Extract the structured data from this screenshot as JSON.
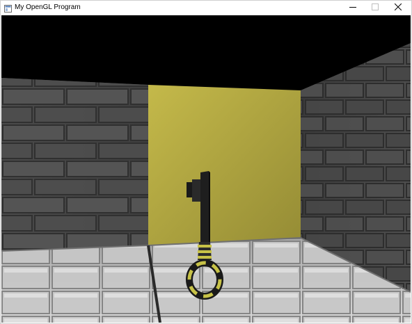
{
  "window": {
    "title": "My OpenGL Program",
    "controls": {
      "minimize_icon": "minimize-icon",
      "maximize_icon": "maximize-icon",
      "close_icon": "close-icon"
    }
  },
  "scene": {
    "background_color": "#000000",
    "wall_color": "#5a5a5a",
    "mortar_color": "#3a3a3a",
    "floor_color": "#c9c9c9",
    "door_color": "#b3a940",
    "key_shaft_color": "#1e1e1e",
    "key_ring_color": "#c7c247"
  }
}
